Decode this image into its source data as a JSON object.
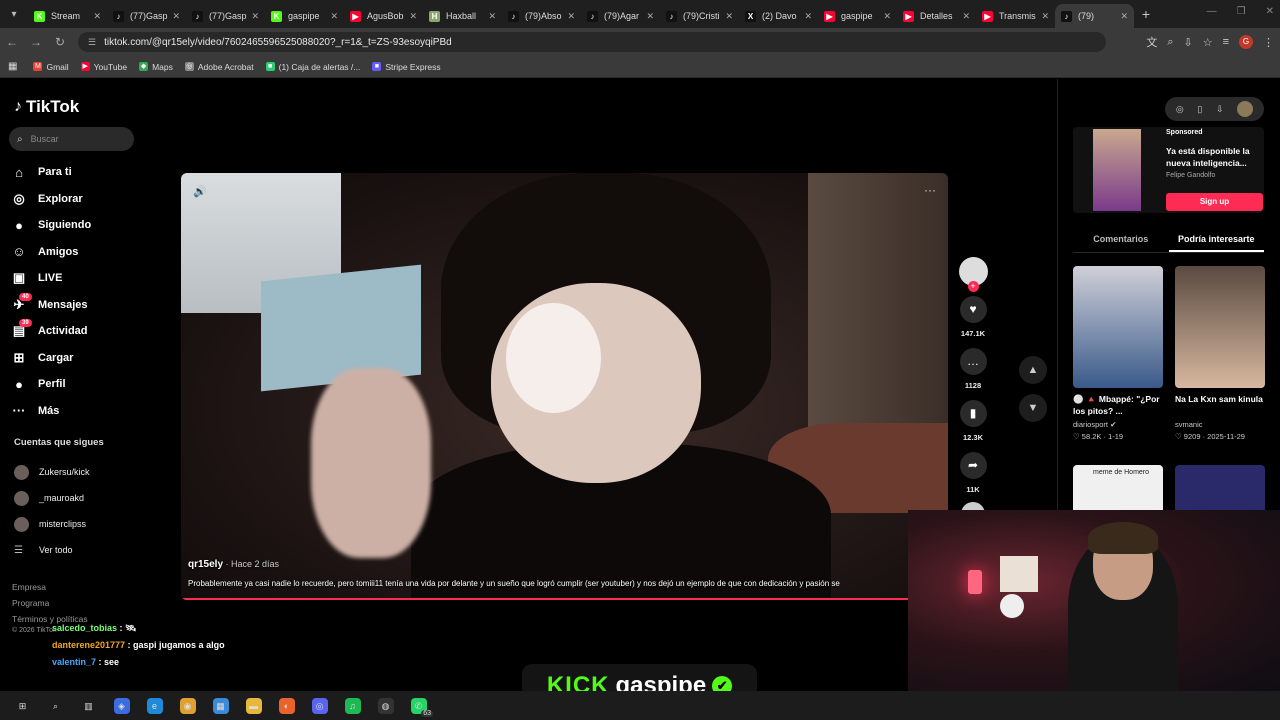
{
  "browser": {
    "tabs": [
      {
        "title": "Stream",
        "fav": "K",
        "color": "#53fc18",
        "active": false
      },
      {
        "title": "(77)Gasp",
        "fav": "♪",
        "color": "#111111",
        "active": false
      },
      {
        "title": "(77)Gasp",
        "fav": "♪",
        "color": "#111111",
        "active": false
      },
      {
        "title": "gaspipe",
        "fav": "K",
        "color": "#53fc18",
        "active": false
      },
      {
        "title": "AgusBob",
        "fav": "▶",
        "color": "#ff0033",
        "active": false
      },
      {
        "title": "Haxball",
        "fav": "H",
        "color": "#8aa86a",
        "active": false
      },
      {
        "title": "(79)Abso",
        "fav": "♪",
        "color": "#111111",
        "active": false
      },
      {
        "title": "(79)Agar",
        "fav": "♪",
        "color": "#111111",
        "active": false
      },
      {
        "title": "(79)Cristi",
        "fav": "♪",
        "color": "#111111",
        "active": false
      },
      {
        "title": "(2) Davo",
        "fav": "X",
        "color": "#111111",
        "active": false
      },
      {
        "title": "gaspipe",
        "fav": "▶",
        "color": "#ff0033",
        "active": false
      },
      {
        "title": "Detalles",
        "fav": "▶",
        "color": "#ff0033",
        "active": false
      },
      {
        "title": "Transmis",
        "fav": "▶",
        "color": "#ff0033",
        "active": false
      },
      {
        "title": "(79)",
        "fav": "♪",
        "color": "#111111",
        "active": true
      }
    ],
    "url": "tiktok.com/@qr15ely/video/7602465596525088020?_r=1&_t=ZS-93esoyqiPBd",
    "profile_initial": "G",
    "bookmarks": [
      {
        "label": "Gmail",
        "color": "#ea4335",
        "glyph": "M"
      },
      {
        "label": "YouTube",
        "color": "#ff0033",
        "glyph": "▶"
      },
      {
        "label": "Maps",
        "color": "#34a853",
        "glyph": "◆"
      },
      {
        "label": "Adobe Acrobat",
        "color": "#888888",
        "glyph": "◎"
      },
      {
        "label": "(1) Caja de alertas /...",
        "color": "#2ecc71",
        "glyph": "■"
      },
      {
        "label": "Stripe Express",
        "color": "#635bff",
        "glyph": "■"
      }
    ]
  },
  "tiktok": {
    "logo": "TikTok",
    "search_placeholder": "Buscar",
    "nav": [
      {
        "label": "Para ti",
        "icon": "⌂",
        "name": "home-icon"
      },
      {
        "label": "Explorar",
        "icon": "◎",
        "name": "compass-icon"
      },
      {
        "label": "Siguiendo",
        "icon": "●",
        "name": "following-icon"
      },
      {
        "label": "Amigos",
        "icon": "☺",
        "name": "friends-icon"
      },
      {
        "label": "LIVE",
        "icon": "▣",
        "name": "live-icon"
      },
      {
        "label": "Mensajes",
        "icon": "✈",
        "name": "messages-icon",
        "badge": "40"
      },
      {
        "label": "Actividad",
        "icon": "▤",
        "name": "activity-icon",
        "badge": "39"
      },
      {
        "label": "Cargar",
        "icon": "⊞",
        "name": "upload-icon"
      },
      {
        "label": "Perfil",
        "icon": "●",
        "name": "profile-icon"
      },
      {
        "label": "Más",
        "icon": "···",
        "name": "more-icon"
      }
    ],
    "following_header": "Cuentas que sigues",
    "following": [
      "Zukersu/kick",
      "_mauroakd",
      "misterclipss"
    ],
    "see_all": "Ver todo",
    "footer": [
      "Empresa",
      "Programa",
      "Términos y políticas"
    ],
    "copyright": "© 2026 TikTok",
    "video": {
      "author": "qr15ely",
      "when": " · Hace 2 días",
      "caption": "Probablemente ya casi nadie lo recuerde, pero tomiii11 tenía una vida por delante y un sueño que logró cumplir (ser youtuber) y nos dejó un ejemplo de que con dedicación y pasión se",
      "progress": 0.95
    },
    "actions": [
      {
        "icon": "♥",
        "count": "147.1K",
        "name": "like"
      },
      {
        "icon": "…",
        "count": "1128",
        "name": "comment"
      },
      {
        "icon": "▮",
        "count": "12.3K",
        "name": "bookmark"
      },
      {
        "icon": "➦",
        "count": "11K",
        "name": "share"
      }
    ],
    "ad": {
      "sponsored": "Sponsored",
      "title": "Ya está disponible la nueva inteligencia...",
      "name": "Felipe Gandolfo",
      "button": "Sign up"
    },
    "panel_tabs": [
      "Comentarios",
      "Podría interesarte"
    ],
    "recommendations": [
      {
        "title": "⚪ 🔺 Mbappé: \"¿Por los pitos? ...",
        "author": "diariosport ✔",
        "meta": "♡ 58.2K · 1-19",
        "c1": "#3a5a8a",
        "c2": "#d0d0d8"
      },
      {
        "title": "Na La Kxn sam kinula",
        "author": "svmanic",
        "meta": "♡ 9209 · 2025-11-29",
        "c1": "#d8b8a0",
        "c2": "#5a4a40"
      }
    ],
    "rec_thumbs_lower": [
      {
        "label": "meme de Homero",
        "c1": "#f0f0f0"
      },
      {
        "label": "",
        "c1": "#2a2a6a"
      }
    ]
  },
  "chat": [
    {
      "user": "salcedo_tobias",
      "msg": " : 🛰"
    },
    {
      "user": "danterene201777",
      "msg": " : gaspi jugamos a algo"
    },
    {
      "user": "valentin_7",
      "msg": " : see"
    }
  ],
  "kick": {
    "logo": "KICK",
    "name": "gaspipe",
    "check": "✔"
  },
  "taskbar": [
    {
      "glyph": "⊞",
      "color": "#1c1c1c",
      "name": "start-icon"
    },
    {
      "glyph": "⌕",
      "color": "#1c1c1c",
      "name": "search-icon"
    },
    {
      "glyph": "▥",
      "color": "#1c1c1c",
      "name": "task-view-icon"
    },
    {
      "glyph": "◈",
      "color": "#3b6de0",
      "name": "copilot-icon"
    },
    {
      "glyph": "e",
      "color": "#1f8ad8",
      "name": "edge-icon"
    },
    {
      "glyph": "◉",
      "color": "#e0a030",
      "name": "chrome-icon"
    },
    {
      "glyph": "▦",
      "color": "#3a8ad8",
      "name": "store-icon"
    },
    {
      "glyph": "▬",
      "color": "#e8b83a",
      "name": "file-explorer-icon"
    },
    {
      "glyph": "◐",
      "color": "#e8642a",
      "name": "firefox-icon"
    },
    {
      "glyph": "◎",
      "color": "#5865f2",
      "name": "discord-icon"
    },
    {
      "glyph": "♫",
      "color": "#1db954",
      "name": "spotify-icon"
    },
    {
      "glyph": "◍",
      "color": "#333333",
      "name": "obs-icon"
    },
    {
      "glyph": "✆",
      "color": "#25d366",
      "name": "whatsapp-icon",
      "badge": "63"
    }
  ]
}
